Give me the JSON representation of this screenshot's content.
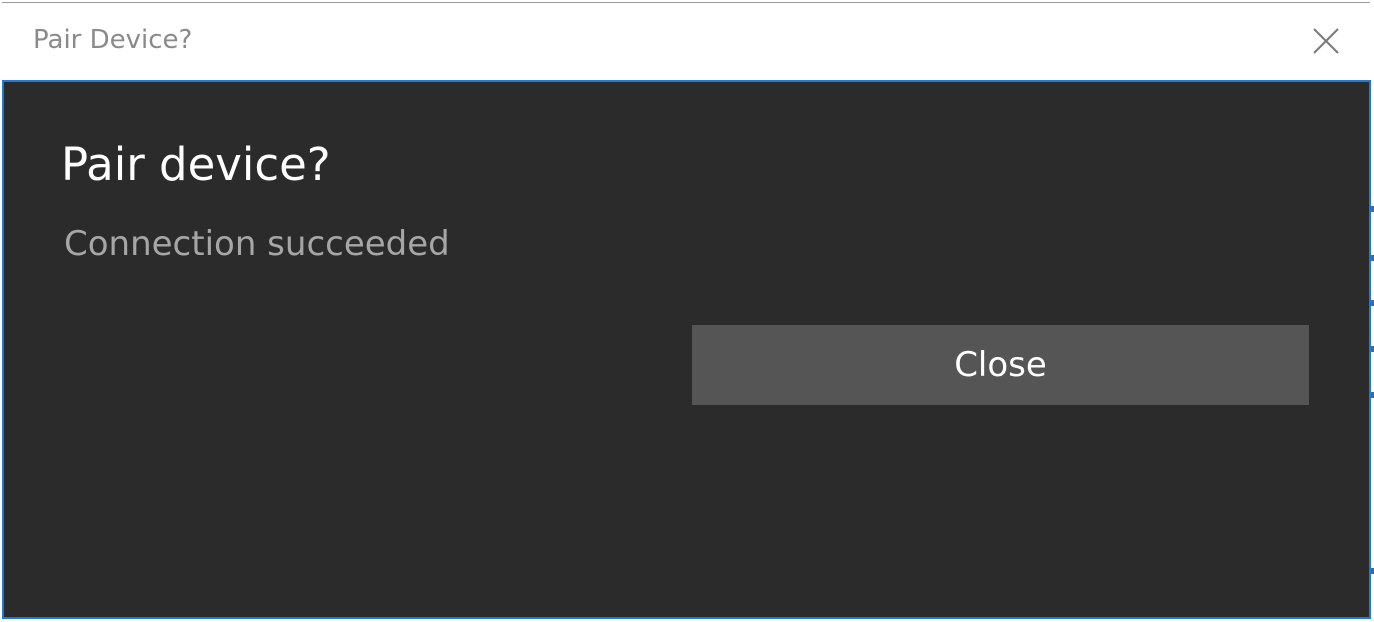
{
  "window": {
    "title": "Pair Device?",
    "close_icon": "close-icon"
  },
  "dialog": {
    "heading": "Pair device?",
    "message": "Connection succeeded",
    "close_button_label": "Close"
  },
  "colors": {
    "dialog_background": "#2b2b2b",
    "dialog_border": "#1e7ad4",
    "button_background": "#555555",
    "heading_text": "#ffffff",
    "message_text": "#a6a6a6",
    "title_text": "#8a8a8a"
  }
}
